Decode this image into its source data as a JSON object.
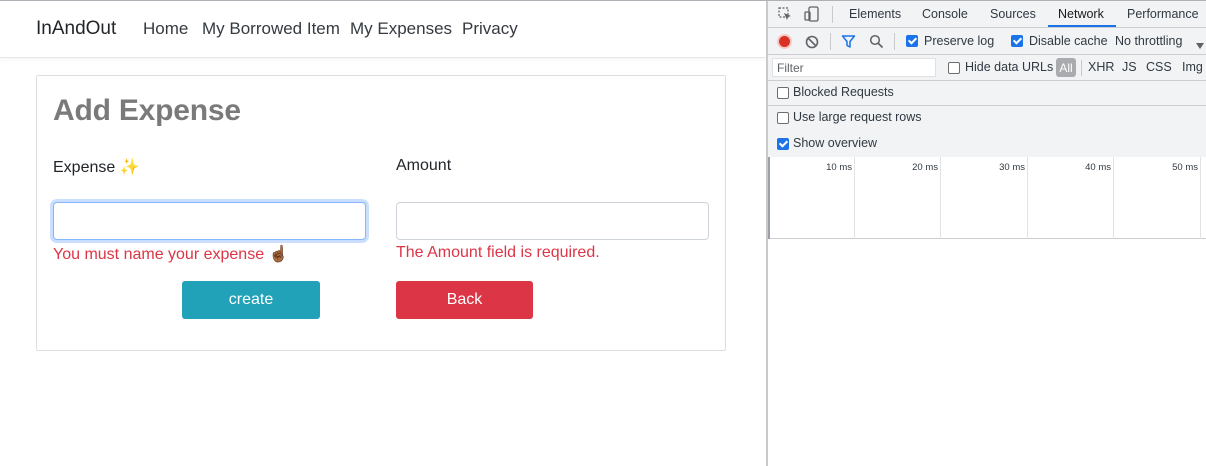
{
  "nav": {
    "brand": "InAndOut",
    "links": [
      "Home",
      "My Borrowed Item",
      "My Expenses",
      "Privacy"
    ]
  },
  "form": {
    "title": "Add Expense",
    "expense_label": "Expense ✨",
    "amount_label": "Amount",
    "expense_value": "",
    "amount_value": "",
    "expense_error": "You must name your expense ☝🏾",
    "amount_error": "The Amount field is required.",
    "create_label": "create",
    "back_label": "Back"
  },
  "devtools": {
    "tabs": [
      "Elements",
      "Console",
      "Sources",
      "Network",
      "Performance"
    ],
    "active_tab": "Network",
    "preserve_log": "Preserve log",
    "disable_cache": "Disable cache",
    "throttling": "No throttling",
    "filter_placeholder": "Filter",
    "hide_data_urls": "Hide data URLs",
    "type_filters": [
      "All",
      "XHR",
      "JS",
      "CSS",
      "Img"
    ],
    "blocked_requests": "Blocked Requests",
    "large_rows": "Use large request rows",
    "show_overview": "Show overview",
    "timeline_ticks": [
      "10 ms",
      "20 ms",
      "30 ms",
      "40 ms",
      "50 ms"
    ]
  },
  "colors": {
    "accent": "#1a73e8",
    "create": "#22a2b8",
    "back": "#dc3545",
    "error": "#dc3545"
  }
}
